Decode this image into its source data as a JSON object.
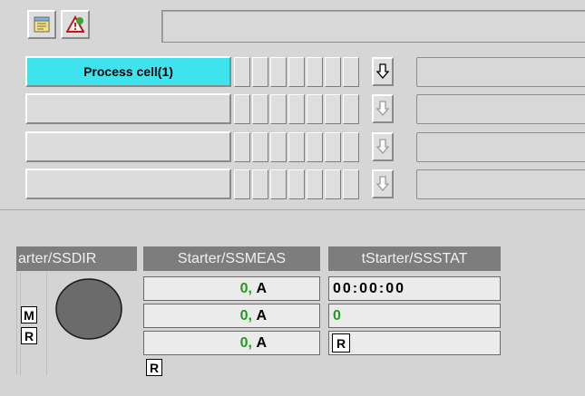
{
  "toolbar": {
    "icons": [
      "notepad-icon",
      "alarm-warning-icon"
    ],
    "title": ""
  },
  "process_cells": [
    {
      "label": "Process cell(1)",
      "active": true
    },
    {
      "label": "",
      "active": false
    },
    {
      "label": "",
      "active": false
    },
    {
      "label": "",
      "active": false
    }
  ],
  "direction_panel": {
    "header": "arter/SSDIR",
    "mode_tag": "M",
    "reset_tag": "R"
  },
  "measure_panel": {
    "header": "Starter/SSMEAS",
    "rows": [
      {
        "value": "0",
        "unit": "A"
      },
      {
        "value": "0",
        "unit": "A"
      },
      {
        "value": "0",
        "unit": "A"
      }
    ],
    "reset_tag": "R"
  },
  "status_panel": {
    "header": "tStarter/SSSTAT",
    "time": "00:00:00",
    "count": "0",
    "reset_tag": "R"
  },
  "colors": {
    "active_cell": "#3fe3ee",
    "value_green": "#1f9d1f",
    "header_bg": "#7d7d7d",
    "motor_gray": "#6b6b6b"
  }
}
